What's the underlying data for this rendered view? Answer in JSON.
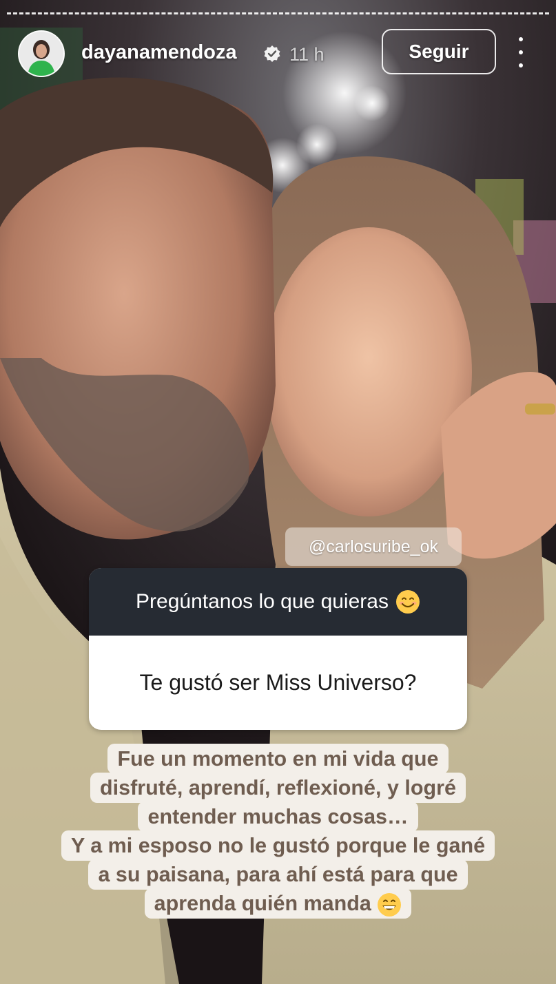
{
  "story": {
    "progress_segments": 1,
    "header": {
      "username": "dayanamendoza",
      "verified": true,
      "time_ago": "11 h",
      "follow_label": "Seguir",
      "more_icon": "more-vertical-icon"
    },
    "mention": "@carlosuribe_ok",
    "question_card": {
      "prompt": "Pregúntanos lo que quieras",
      "prompt_emoji": "smiling-face-icon",
      "question": "Te gustó ser Miss Universo?",
      "header_color": "#262b33"
    },
    "answer": {
      "lines": [
        "Fue un momento en mi vida que",
        "disfruté, aprendí, reflexioné, y logré",
        "entender muchas cosas…",
        "Y a mi esposo no le gustó porque le gané",
        "a su paisana, para ahí está para que",
        "aprenda quién manda"
      ],
      "end_emoji": "grinning-face-icon",
      "text_color": "#6f5d50",
      "bg_color": "#f3efe9"
    }
  }
}
